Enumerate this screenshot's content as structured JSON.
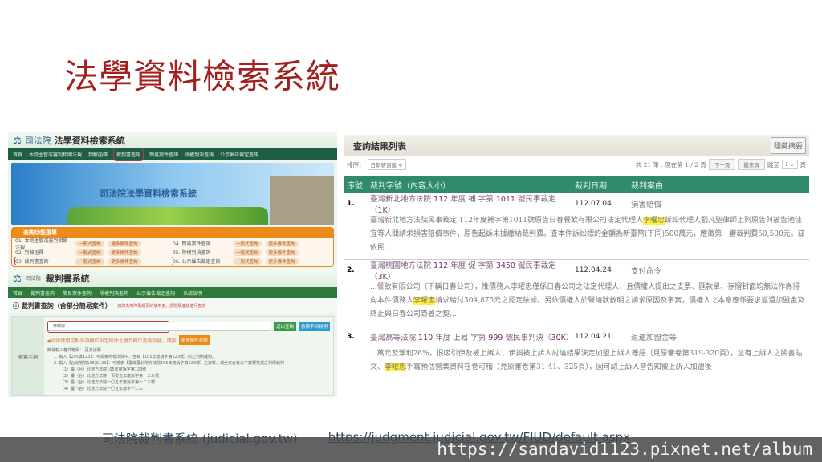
{
  "slide_title": "法學資料檢索系統",
  "left": {
    "court": "司法院",
    "sys1": "法學資料檢索系統",
    "nav1": [
      "首頁",
      "本院主管或審判相關法規",
      "判解函釋",
      "裁判書查詢",
      "簡易案件查詢",
      "除權判決查詢",
      "公示催告裁定查詢"
    ],
    "banner_title": "司法院法學資料檢索系統",
    "menu_title": "查詢功能選單",
    "menu_items": [
      "01. 本院主管或審判相關法規",
      "04. 簡易案件查詢",
      "02. 判解函釋",
      "05. 除權判決查詢",
      "03. 裁判書查詢",
      "06. 公示催告裁定查詢"
    ],
    "pill_simple": "一般式查詢",
    "pill_more": "更多條件查詢",
    "sys2": "裁判書系統",
    "nav2": [
      "首頁",
      "裁判書查詢",
      "簡易案件查詢",
      "除權判決查詢",
      "公示催告裁定查詢",
      "系統說明"
    ],
    "query_title": "裁判書查詢（含部分簡易案件）",
    "query_note": "- 如您為無障礙網頁的使用者，請點擊連結進行查詢",
    "field_label": "檢索字詞",
    "search_value": "李曜忠",
    "btn_search": "送出查詢",
    "btn_help": "檢索字詞說明",
    "hint": "◆如欲使用可對各項欄位設定條件之複合欄位查詢功能，請按",
    "btn_more": "更多條件查詢",
    "examples": [
      "簡易輸入格式範例： 更多說明",
      "1. 輸入【105訴123】：可檢索所有法院中，含有【105年度訴字第123號】的之判例裁判。",
      "2. 輸入【台北地院105訴123】：可檢索【臺灣臺北地方法院105年度訴字第123號】之資料，或全文含有以下案號格式之判例裁判",
      "（1）臺（台）北地方法院105年度訴字第123號",
      "（2）臺（台）北地方法院一百零五年度訴字第一二三號",
      "（3）臺（台）北地方法院一〇五年度訴字第一二三號",
      "（4）臺（台）北地方法院一〇五年訴字一二三"
    ]
  },
  "right": {
    "title": "查詢結果列表",
    "hide_btn": "隱藏摘要",
    "sort_label": "排序：",
    "sort_value": "日期新到舊 ≑",
    "page_info": "共 21 筆 . 現在第 1 / 2 頁",
    "next": "下一頁",
    "last": "最末頁",
    "jump": "跳至",
    "page_sel": "1 ⌄",
    "page_unit": "頁",
    "headers": [
      "序號",
      "裁判字號（內容大小）",
      "裁判日期",
      "裁判案由"
    ],
    "results": [
      {
        "no": "1.",
        "court": "臺灣新北地方法院",
        "year": "112",
        "mid1": "年度 補 字第",
        "num": "1011",
        "tail": "號民事裁定（",
        "size": "1K",
        "close": "）",
        "date": "112.07.04",
        "cause": "損害賠償",
        "pre": "臺灣新北地方法院民事裁定 112年度補字第1011號原告日春餐飲有限公司法定代理人",
        "hl": "李曜忠",
        "post": "訴訟代理人劉凡聖律師上列原告與被告池佳宜等人間請求損害賠償事件，原告起訴未據繳納裁判費。查本件訴訟標的金額為新臺幣(下同)500萬元，應徵第一審裁判費50,500元。茲依民..."
      },
      {
        "no": "2.",
        "court": "臺灣桃園地方法院",
        "year": "112",
        "mid1": "年度 促 字第",
        "num": "3450",
        "tail": "號民事裁定（",
        "size": "3K",
        "close": "）",
        "date": "112.04.24",
        "cause": "支付命令",
        "pre": "...餐飲有限公司（下稱日春公司），惟債務人李曜忠僅係日春公司之法定代理人，且債權人提出之支票、匯款單、存摺封面均無法作為得向本件債務人",
        "hl": "李曜忠",
        "post": "請求給付304,875元之認定依據。另依債權人於聲請狀敘明之請求原因及事實，債權人之本意應係要求返還加盟金及終止與日春公司簽署之契..."
      },
      {
        "no": "3.",
        "court": "臺灣高等法院",
        "year": "110",
        "mid1": "年度 上易 字第",
        "num": "999",
        "tail": "號民事判決（",
        "size": "30K",
        "close": "）",
        "date": "112.04.21",
        "cause": "返還加盟金等",
        "pre": "...萬元及淨利26%，很吸引伊及被上訴人，伊與被上訴人討論結果決定加盟上訴人等語（見原審卷第319-320頁），並有上訴人之臉書貼文、",
        "hl": "李曜忠",
        "post": "手寫預估營業資料在卷可稽（見原審卷第31-41、325頁），固可認上訴人曾告知被上訴人加盟後"
      }
    ]
  },
  "links": [
    "司法院裁判書系統 (judicial.gov.tw)",
    "https://judgment.judicial.gov.tw/FJUD/default.aspx"
  ],
  "watermark": "https://sandavid1123.pixnet.net/album"
}
